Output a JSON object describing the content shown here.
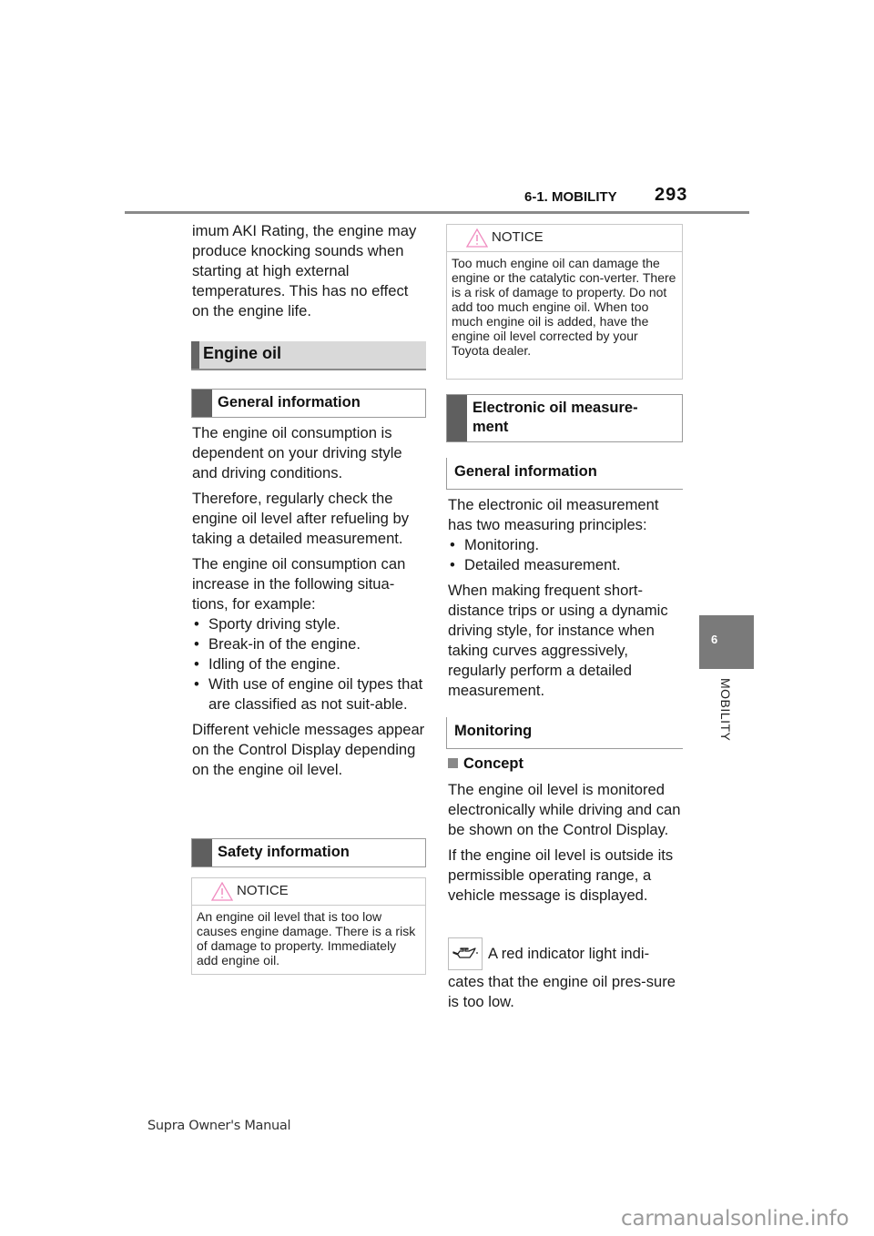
{
  "header": {
    "section": "6-1. MOBILITY",
    "page_number": "293"
  },
  "side_tab": {
    "chapter_number": "6",
    "chapter_label": "MOBILITY"
  },
  "left_column": {
    "intro_text": "imum AKI Rating, the engine may produce knocking sounds when starting at high external temperatures. This has no effect on the engine life.",
    "engine_oil_heading": "Engine oil",
    "general_info_heading": "General information",
    "paragraphs": [
      "The engine oil consumption is dependent on your driving style and driving conditions.",
      "Therefore, regularly check the engine oil level after refueling by taking a detailed measurement.",
      "The engine oil consumption can increase in the following situa-tions, for example:"
    ],
    "bullets": [
      "Sporty driving style.",
      "Break-in of the engine.",
      "Idling of the engine.",
      "With use of engine oil types that are classified as not suit-able."
    ],
    "after_bullets": "Different vehicle messages appear on the Control Display depending on the engine oil level.",
    "safety_heading": "Safety information",
    "notice": {
      "label": "NOTICE",
      "icon": "warning-triangle-icon",
      "text": "An engine oil level that is too low causes engine damage. There is a risk of damage to property. Immediately add engine oil."
    }
  },
  "right_column": {
    "notice": {
      "label": "NOTICE",
      "icon": "warning-triangle-icon",
      "text": "Too much engine oil can damage the engine or the catalytic con-verter. There is a risk of damage to property. Do not add too much engine oil. When too much engine oil is added, have the engine oil level corrected by your Toyota dealer."
    },
    "electronic_heading": "Electronic oil measure-ment",
    "general_info_heading": "General information",
    "intro": "The electronic oil measurement has two measuring principles:",
    "bullets": [
      "Monitoring.",
      "Detailed measurement."
    ],
    "paragraph": "When making frequent short-distance trips or using a dynamic driving style, for instance when taking curves aggressively, regularly perform a detailed measurement.",
    "monitoring_heading": "Monitoring",
    "concept_heading": "Concept",
    "concept_paragraphs": [
      "The engine oil level is monitored electronically while driving and can be shown on the Control Display.",
      "If the engine oil level is outside its permissible operating range, a vehicle message is displayed."
    ],
    "indicator": {
      "icon": "oil-can-icon",
      "text_first_line": "A red indicator light indi-",
      "text_rest": "cates that the engine oil pres-sure is too low."
    }
  },
  "footer": {
    "manual_title": "Supra Owner's Manual",
    "watermark": "carmanualsonline.info"
  },
  "colors": {
    "warning_triangle": "#f08cc0",
    "heading_bar": "#5f5f5f",
    "side_tab": "#7a7a7a"
  }
}
